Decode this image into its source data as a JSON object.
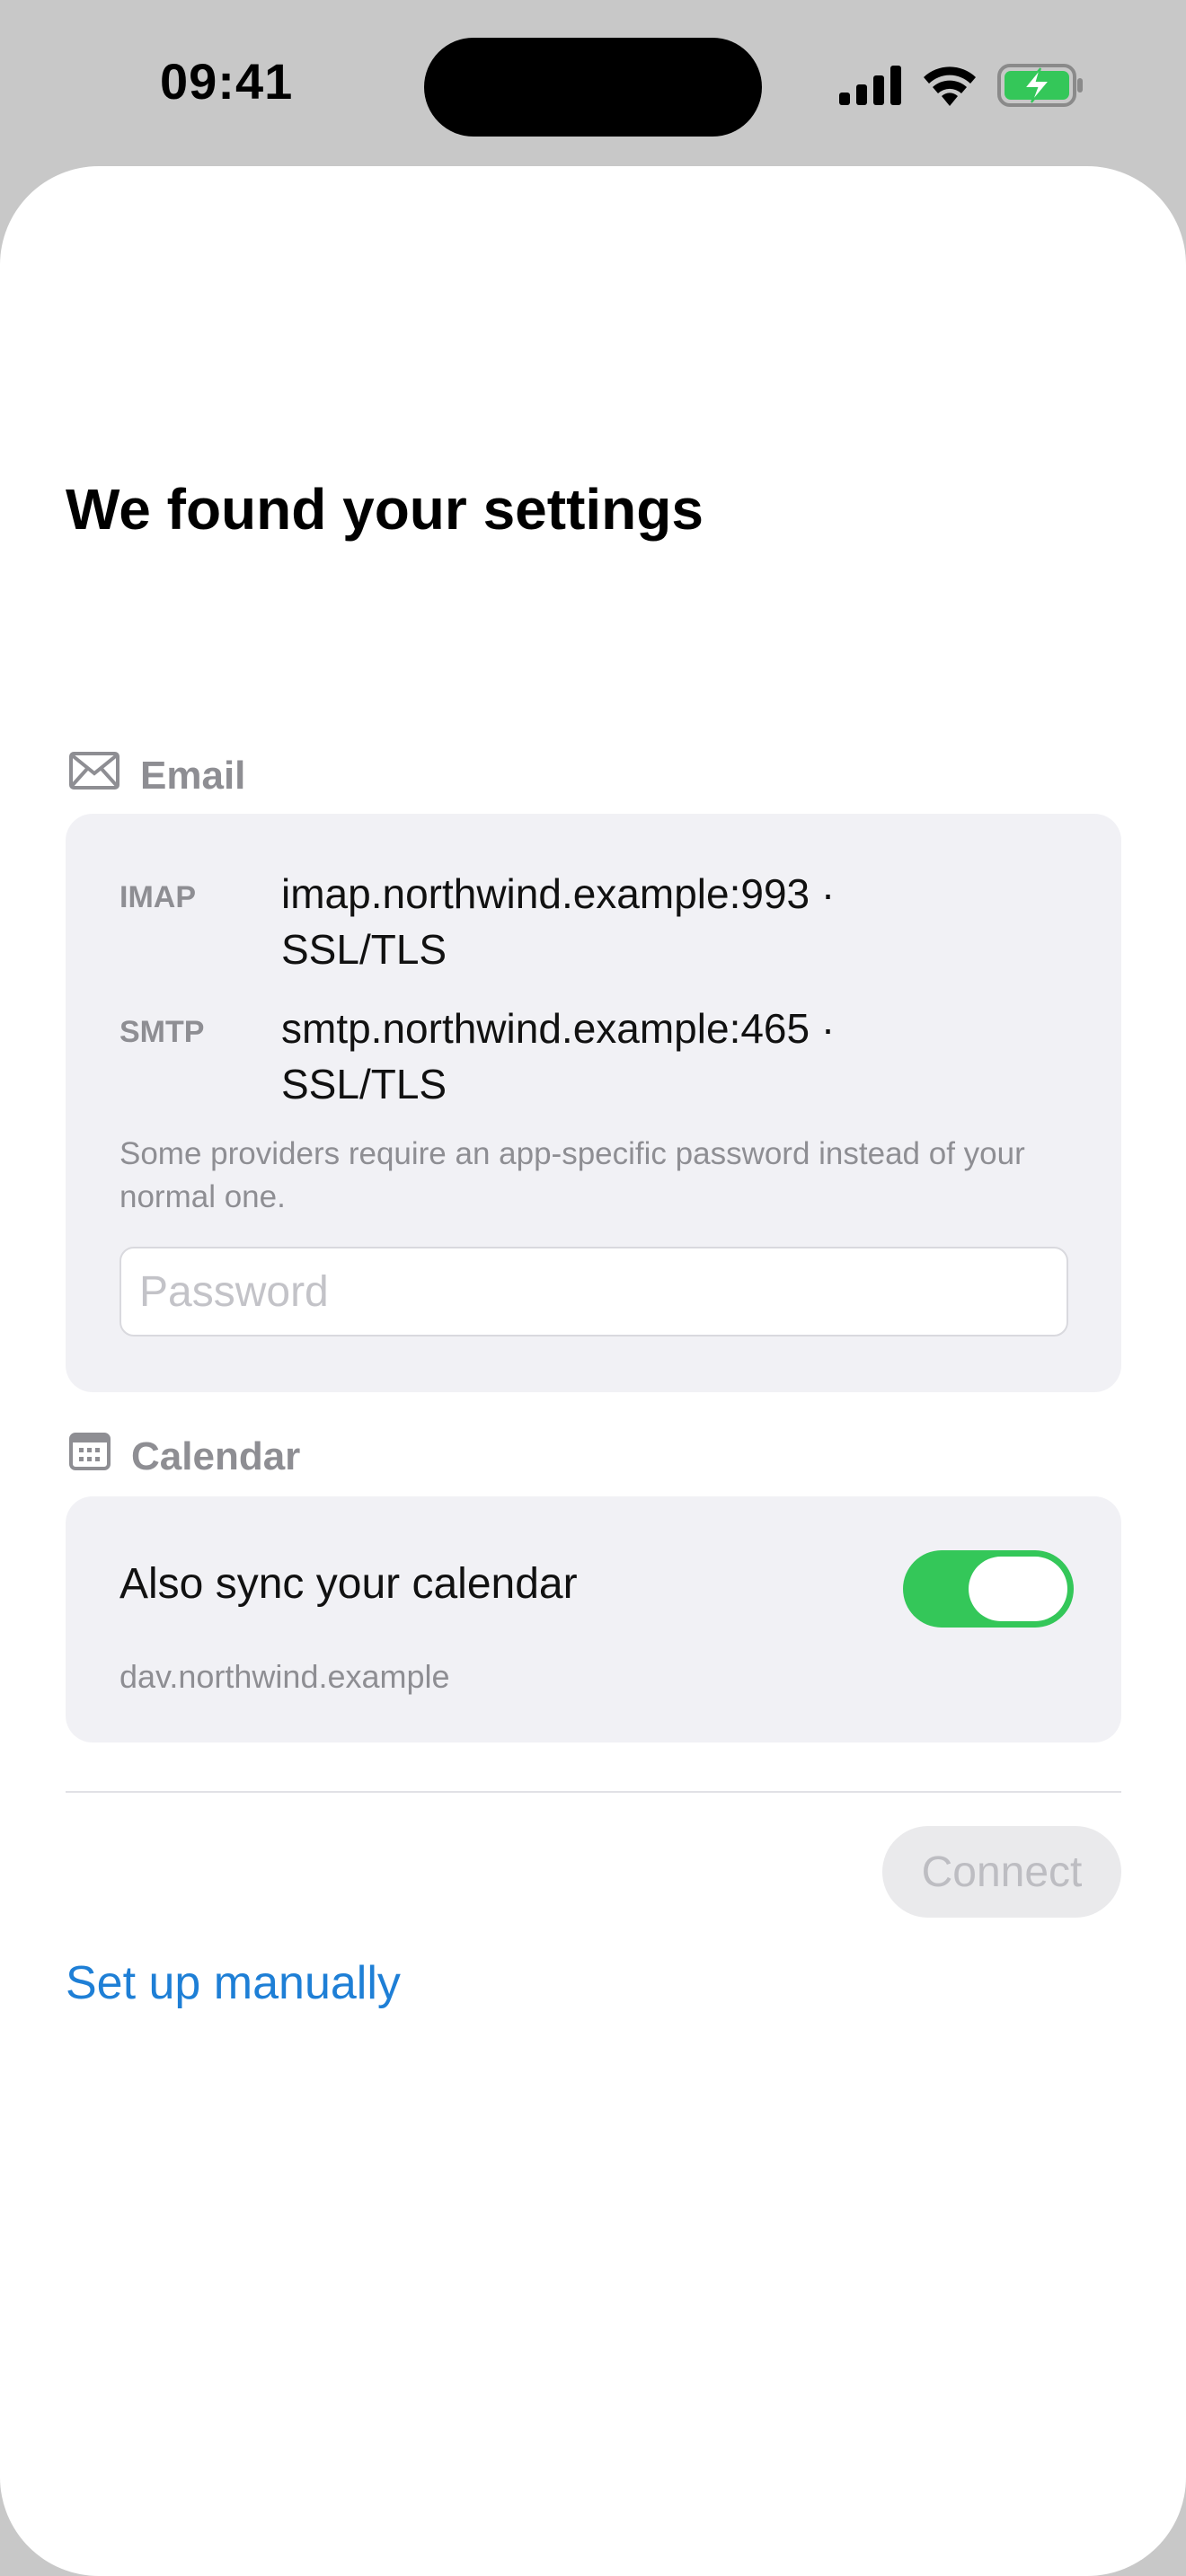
{
  "status_bar": {
    "time": "09:41"
  },
  "page": {
    "title": "We found your settings"
  },
  "email_section": {
    "header": "Email",
    "icon": "envelope-icon",
    "servers": [
      {
        "protocol": "IMAP",
        "value": "imap.northwind.example:993 · SSL/TLS"
      },
      {
        "protocol": "SMTP",
        "value": "smtp.northwind.example:465 · SSL/TLS"
      }
    ],
    "note": "Some providers require an app-specific password instead of your normal one.",
    "password_placeholder": "Password",
    "password_value": ""
  },
  "calendar_section": {
    "header": "Calendar",
    "icon": "calendar-icon",
    "sync_label": "Also sync your calendar",
    "sync_enabled": true,
    "host": "dav.northwind.example"
  },
  "actions": {
    "connect_label": "Connect",
    "manual_label": "Set up manually"
  },
  "colors": {
    "toggle_on": "#34c759",
    "link": "#1e7fd6",
    "card_background": "#f1f1f5"
  }
}
